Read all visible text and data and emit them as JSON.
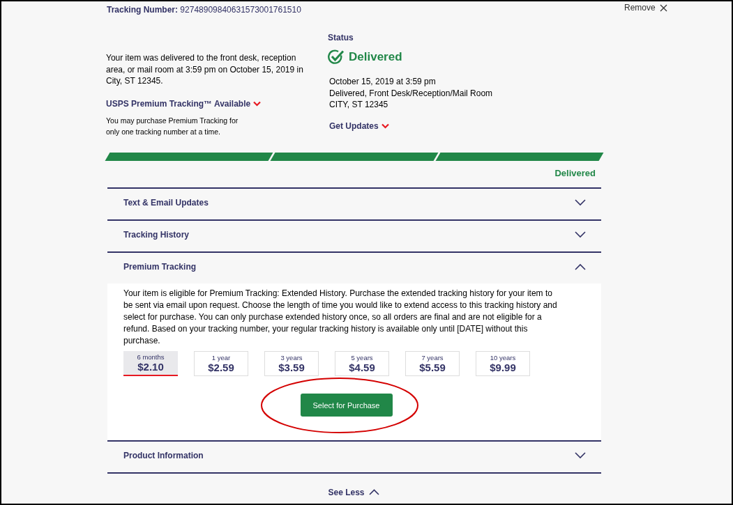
{
  "tracking": {
    "label": "Tracking Number:",
    "number": "92748909840631573001761510"
  },
  "remove": {
    "label": "Remove"
  },
  "summary": {
    "message": "Your item was delivered to the front desk, reception area, or mail room at 3:59 pm on October 15, 2019 in City, ST 12345.",
    "premium_link": "USPS Premium Tracking™ Available",
    "premium_note": "You may purchase Premium Tracking for only one tracking number at a time."
  },
  "status": {
    "label": "Status",
    "value": "Delivered",
    "lines": [
      "October 15, 2019 at 3:59 pm",
      "Delivered, Front Desk/Reception/Mail Room",
      "CITY, ST 12345"
    ],
    "updates_link": "Get Updates"
  },
  "progress": {
    "segments": [
      {
        "complete": true
      },
      {
        "complete": true
      },
      {
        "complete": true
      }
    ],
    "label": "Delivered"
  },
  "sections": [
    {
      "title": "Text & Email Updates",
      "expanded": false
    },
    {
      "title": "Tracking History",
      "expanded": false
    },
    {
      "title": "Premium Tracking",
      "expanded": true,
      "body": "Your item is eligible for Premium Tracking: Extended History. Purchase the extended tracking history for your item to be sent via email upon request. Choose the length of time you would like to extend access to this tracking history and select for purchase. You can only purchase extended history once, so all orders are final and are not eligible for a refund. Based on your tracking number, your regular tracking history is available only until [DATE] without this purchase.",
      "options": [
        {
          "period": "6 months",
          "price": "$2.10",
          "selected": true
        },
        {
          "period": "1 year",
          "price": "$2.59",
          "selected": false
        },
        {
          "period": "3 years",
          "price": "$3.59",
          "selected": false
        },
        {
          "period": "5 years",
          "price": "$4.59",
          "selected": false
        },
        {
          "period": "7 years",
          "price": "$5.59",
          "selected": false
        },
        {
          "period": "10 years",
          "price": "$9.99",
          "selected": false
        }
      ],
      "button": "Select for Purchase"
    },
    {
      "title": "Product Information",
      "expanded": false
    }
  ],
  "see_less": "See Less"
}
